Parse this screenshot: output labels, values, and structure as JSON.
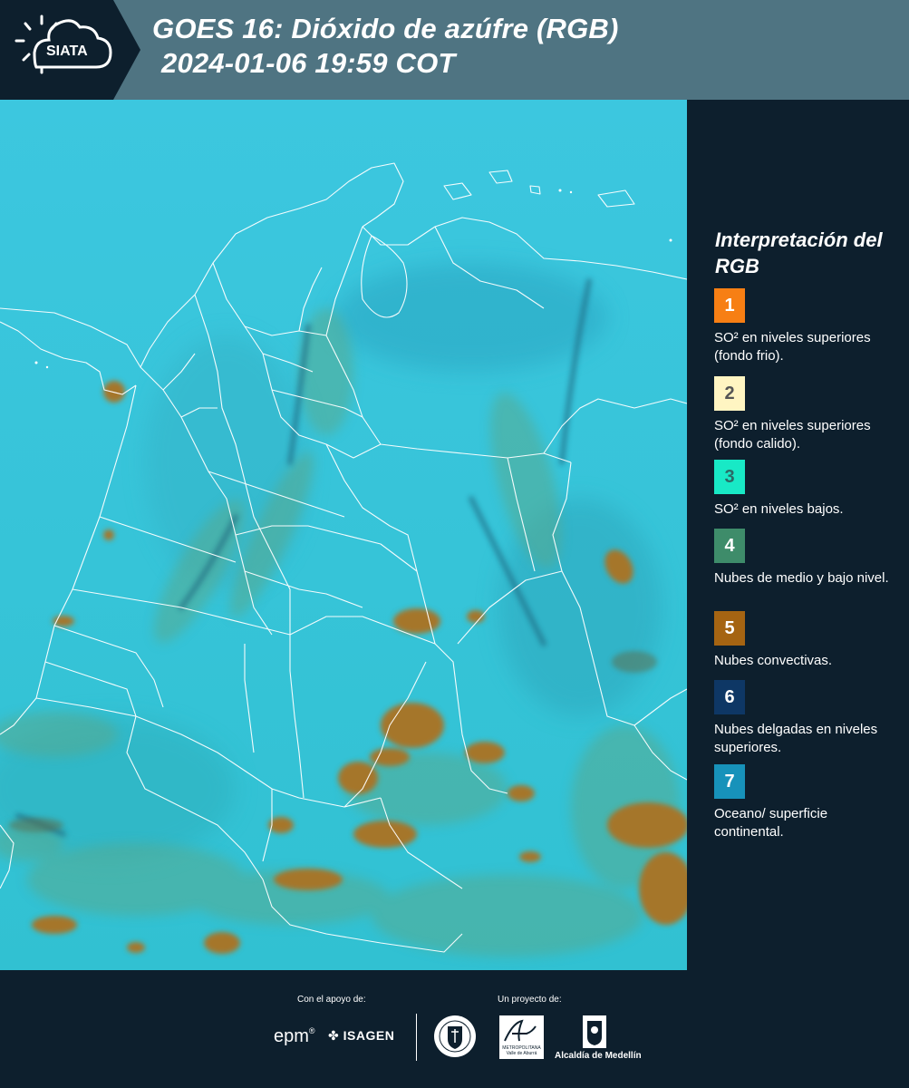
{
  "header": {
    "logo_text": "SIATA",
    "title_line1": "GOES 16: Dióxido de azúfre (RGB)",
    "title_line2": "2024-01-06 19:59 COT"
  },
  "colors": {
    "header_bg": "#4f7482",
    "panel_bg": "#0d1f2d",
    "land_cyan": "#35c3d8",
    "convective_brown": "#a5762b"
  },
  "legend": {
    "title": "Interpretación del RGB",
    "items": [
      {
        "number": "1",
        "color": "#f77f14",
        "text_color": "#ffffff",
        "label": "SO² en niveles superiores (fondo frio)."
      },
      {
        "number": "2",
        "color": "#fff5c2",
        "text_color": "#555555",
        "label": "SO² en niveles superiores (fondo calido)."
      },
      {
        "number": "3",
        "color": "#18e9c6",
        "text_color": "#2b6a66",
        "label": "SO² en niveles bajos."
      },
      {
        "number": "4",
        "color": "#3e8c6a",
        "text_color": "#ffffff",
        "label": "Nubes de medio y bajo nivel."
      },
      {
        "number": "5",
        "color": "#a56412",
        "text_color": "#ffffff",
        "label": "Nubes convectivas."
      },
      {
        "number": "6",
        "color": "#0e3765",
        "text_color": "#ffffff",
        "label": "Nubes delgadas en niveles superiores."
      },
      {
        "number": "7",
        "color": "#1792ba",
        "text_color": "#ffffff",
        "label": "Oceano/ superficie continental."
      }
    ]
  },
  "footer": {
    "support_label": "Con el apoyo de:",
    "project_label": "Un proyecto de:",
    "sponsors": [
      "epm",
      "ISAGEN"
    ],
    "partners": [
      "METROPOLITANA",
      "Valle de Aburrá",
      "Alcaldía de Medellín"
    ]
  }
}
